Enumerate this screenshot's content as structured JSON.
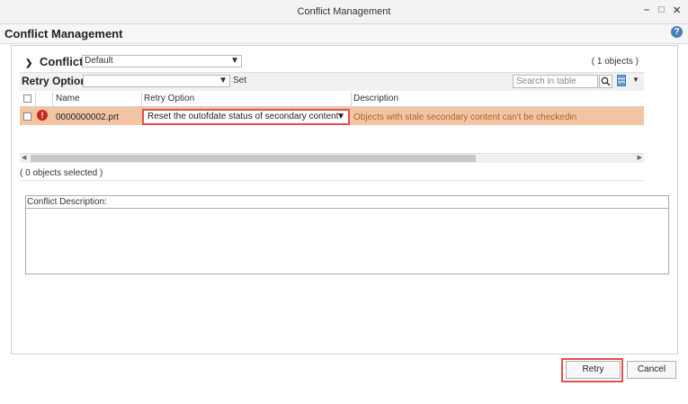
{
  "window": {
    "title": "Conflict Management",
    "minimize": "–",
    "maximize": "□",
    "close": "✕"
  },
  "dialog": {
    "title": "Conflict Management",
    "help": "?"
  },
  "conflicts": {
    "header": "Conflicts",
    "view_select": "Default",
    "count": "( 1 objects )",
    "retry_option_label": "Retry Option",
    "retry_option_value": "",
    "set_label": "Set",
    "search_placeholder": "Search in table",
    "columns": [
      "Name",
      "Retry Option",
      "Description"
    ],
    "rows": [
      {
        "name": "0000000002.prt",
        "retry_option": "Reset the outofdate status of secondary content",
        "description": "Objects with stale secondary content can't be checkedin"
      }
    ],
    "selected_count": "( 0 objects selected )"
  },
  "description_box": {
    "label": "Conflict Description:"
  },
  "buttons": {
    "retry": "Retry",
    "cancel": "Cancel"
  },
  "colors": {
    "row_highlight": "#f2c6a5",
    "error": "#c9271c",
    "annotation": "#e05050",
    "accent": "#4a7fb5"
  }
}
